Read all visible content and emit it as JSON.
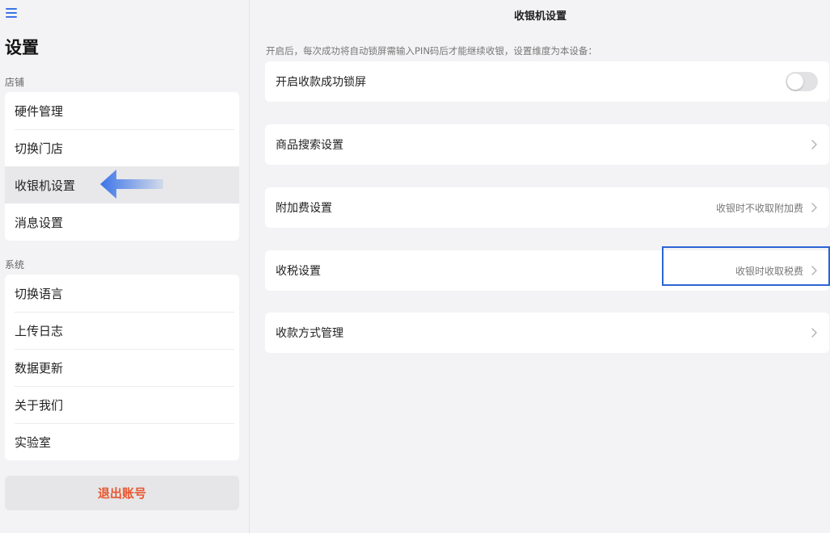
{
  "sidebar": {
    "title": "设置",
    "groups": [
      {
        "label": "店铺",
        "items": [
          {
            "label": "硬件管理"
          },
          {
            "label": "切换门店"
          },
          {
            "label": "收银机设置"
          },
          {
            "label": "消息设置"
          }
        ]
      },
      {
        "label": "系统",
        "items": [
          {
            "label": "切换语言"
          },
          {
            "label": "上传日志"
          },
          {
            "label": "数据更新"
          },
          {
            "label": "关于我们"
          },
          {
            "label": "实验室"
          }
        ]
      }
    ],
    "logout_label": "退出账号"
  },
  "main": {
    "title": "收银机设置",
    "hint": "开启后，每次成功将自动锁屏需输入PIN码后才能继续收银，设置维度为本设备：",
    "rows": [
      {
        "label": "开启收款成功锁屏",
        "toggle_on": false
      },
      {
        "label": "商品搜索设置",
        "value": ""
      },
      {
        "label": "附加费设置",
        "value": "收银时不收取附加费"
      },
      {
        "label": "收税设置",
        "value": "收银时收取税费"
      },
      {
        "label": "收款方式管理",
        "value": ""
      }
    ]
  },
  "colors": {
    "accent": "#3b74e8",
    "logout": "#e8572e",
    "highlight_border": "#2c64d6"
  }
}
